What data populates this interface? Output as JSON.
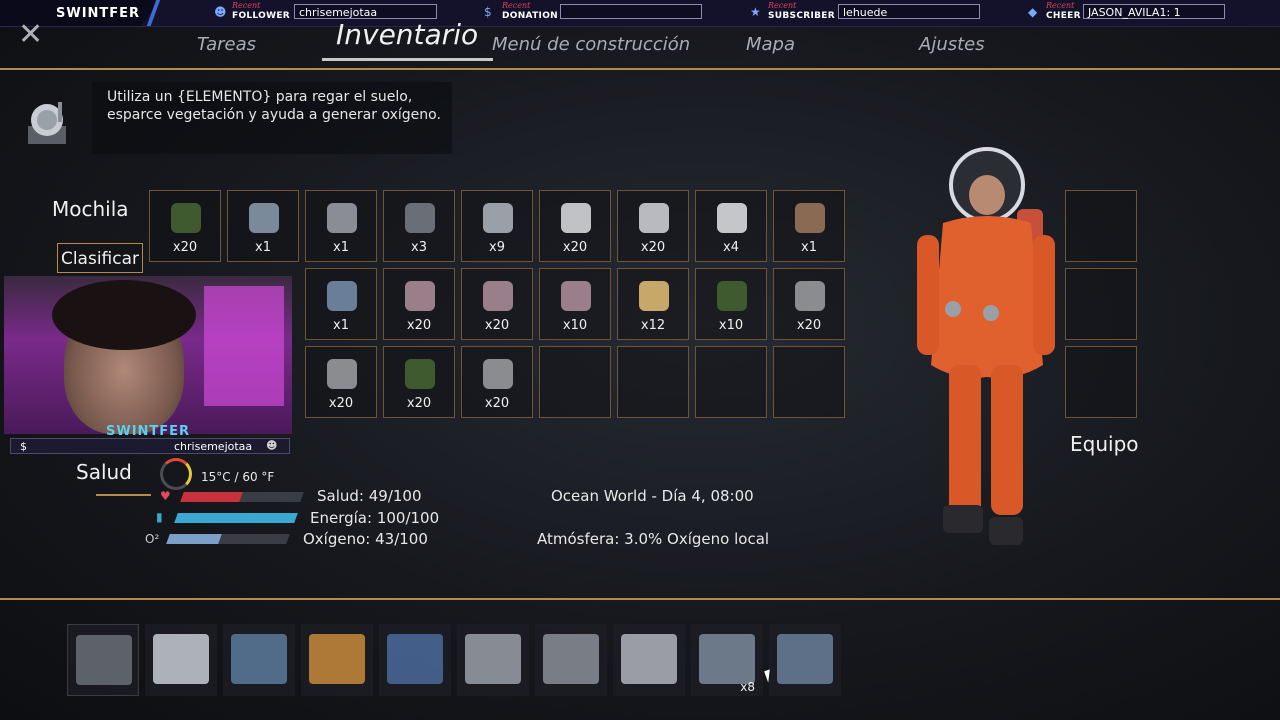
{
  "stream_overlay": {
    "brand": "SWINTFER",
    "recent_label": "Recent",
    "follower": {
      "label": "FOLLOWER",
      "value": "chrisemejotaa"
    },
    "donation": {
      "label": "DONATION",
      "value": ""
    },
    "subscriber": {
      "label": "SUBSCRIBER",
      "value": "lehuede"
    },
    "cheer": {
      "label": "CHEER",
      "value": "JASON_AVILA1: 1"
    }
  },
  "nav": {
    "close_icon": "close-icon",
    "tabs": [
      "Tareas",
      "Inventario",
      "Menú de construcción",
      "Mapa",
      "Ajustes"
    ],
    "active_tab": "Inventario"
  },
  "tooltip": {
    "text": "Utiliza un {ELEMENTO} para regar el suelo, esparce vegetación y ayuda a generar oxígeno."
  },
  "inventory": {
    "title": "Mochila",
    "sort_button": "Clasificar",
    "rows": [
      [
        "x20",
        "x1",
        "x1",
        "x3",
        "x9",
        "x20",
        "x20",
        "x4",
        "x1"
      ],
      [
        "",
        "",
        "x1",
        "x20",
        "x20",
        "x10",
        "x12",
        "x10",
        "x20"
      ],
      [
        "",
        "",
        "x20",
        "x20",
        "x20",
        "",
        "",
        "",
        ""
      ]
    ]
  },
  "webcam": {
    "brand": "SWINTFER",
    "name": "chrisemejotaa"
  },
  "status": {
    "title": "Salud",
    "temperature": "15°C / 60 °F",
    "health": "Salud: 49/100",
    "health_value": 49,
    "energy": "Energía: 100/100",
    "energy_value": 100,
    "oxygen": "Oxígeno: 43/100",
    "oxygen_value": 43,
    "world": "Ocean World - Día 4, 08:00",
    "atmosphere": "Atmósfera: 3.0% Oxígeno local",
    "colors": {
      "health": "#c8323c",
      "energy": "#3aa8d0",
      "oxygen": "#7aa0c8"
    }
  },
  "equipment": {
    "title": "Equipo"
  },
  "hotbar": {
    "items": [
      "",
      "",
      "",
      "",
      "",
      "",
      "",
      "",
      "x8",
      ""
    ]
  }
}
